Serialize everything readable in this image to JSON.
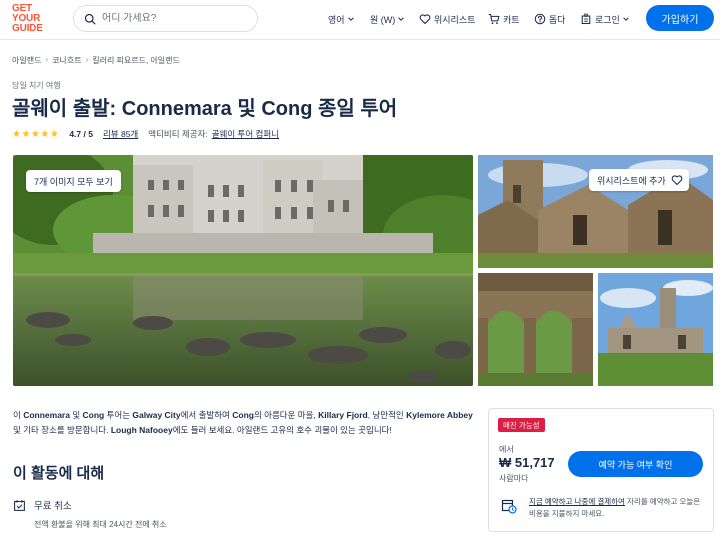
{
  "header": {
    "logo_lines": [
      "GET",
      "YOUR",
      "GUIDE"
    ],
    "search_placeholder": "어디 가세요?",
    "language": "영어",
    "currency": "원 (W)",
    "wishlist": "위시리스트",
    "cart": "카트",
    "help": "돕다",
    "login": "로그인",
    "signup": "가입하기"
  },
  "breadcrumb": [
    "아일랜드",
    "코나흐트",
    "킬러리 피요르드, 아일랜드"
  ],
  "category": "당일 치기 여행",
  "title": "골웨이 출발: Connemara 및 Cong 종일 투어",
  "rating": {
    "stars": "★★★★★",
    "score": "4.7 / 5",
    "reviews": "리뷰 85개",
    "provider_label": "액티비티 제공자:",
    "provider": "골웨이 투어 컴퍼니"
  },
  "gallery": {
    "view_all": "7개 이미지 모두 보기",
    "add_wishlist": "위시리스트에 추가"
  },
  "description": {
    "p1": "이 ",
    "b1": "Connemara",
    "p2": " 및 ",
    "b2": "Cong",
    "p3": " 투어는 ",
    "b3": "Galway City",
    "p4": "에서 출발하여 ",
    "b4": "Cong",
    "p5": "의 아름다운 마을, ",
    "b5": "Killary Fjord",
    "p6": ", 낭만적인 ",
    "b6": "Kylemore Abbey",
    "p7": " 및 기타 장소를 방문합니다. ",
    "b7": "Lough Nafooey",
    "p8": "에도 들러 보세요. 아일랜드 고유의 호수 괴물이 있는 곳입니다!"
  },
  "about": {
    "heading": "이 활동에 대해",
    "free_cancel": "무료 취소",
    "free_cancel_sub": "전액 환불을 위해 최대 24시간 전에 취소"
  },
  "booking": {
    "badge": "매진 가능성",
    "from": "에서",
    "price": "₩ 51,717",
    "per": "사람마다",
    "check": "예약 가능 여부 확인",
    "reserve_link": "지금 예약하고 나중에 결제하여",
    "reserve_rest": " 자리를 예약하고 오늘은 비용을 지불하지 마세요."
  },
  "colors": {
    "brand": "#ff5533",
    "primary": "#0071eb",
    "badge": "#dc1e44",
    "star": "#ffc21a",
    "text": "#1a2b49"
  },
  "icons": [
    "search-icon",
    "chevron-down-icon",
    "heart-icon",
    "cart-icon",
    "help-icon",
    "login-icon",
    "calendar-check-icon",
    "calendar-clock-icon"
  ]
}
